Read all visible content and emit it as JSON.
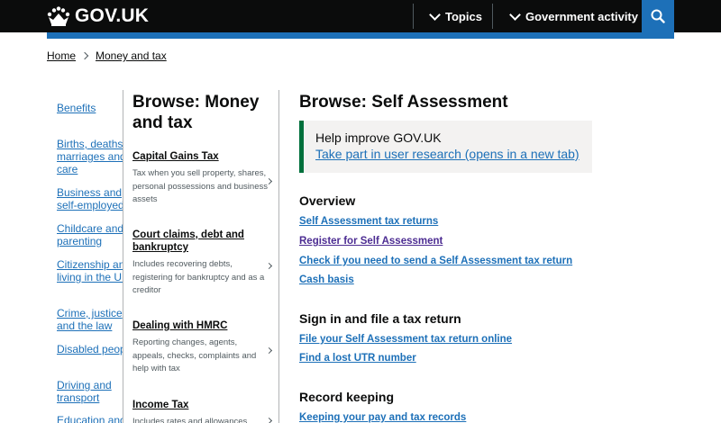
{
  "header": {
    "logo_text": "GOV.UK",
    "nav": [
      {
        "label": "Topics"
      },
      {
        "label": "Government activity"
      }
    ],
    "colors": {
      "header_bg": "#0b0c0c",
      "accent": "#1d70b8"
    }
  },
  "breadcrumb": [
    {
      "label": "Home"
    },
    {
      "label": "Money and tax"
    }
  ],
  "level1": [
    {
      "label": "Benefits"
    },
    {
      "label": "Births, deaths, marriages and care"
    },
    {
      "label": "Business and self-employed"
    },
    {
      "label": "Childcare and parenting"
    },
    {
      "label": "Citizenship and living in the UK"
    },
    {
      "label": "Crime, justice and the law"
    },
    {
      "label": "Disabled people"
    },
    {
      "label": "Driving and transport"
    },
    {
      "label": "Education and learning"
    }
  ],
  "level2": {
    "title": "Browse: Money and tax",
    "items": [
      {
        "title": "Capital Gains Tax",
        "desc": "Tax when you sell property, shares, personal possessions and business assets"
      },
      {
        "title": "Court claims, debt and bankruptcy",
        "desc": "Includes recovering debts, registering for bankruptcy and as a creditor"
      },
      {
        "title": "Dealing with HMRC",
        "desc": "Reporting changes, agents, appeals, checks, complaints and help with tax"
      },
      {
        "title": "Income Tax",
        "desc": "Includes rates and allowances"
      }
    ]
  },
  "main": {
    "title": "Browse: Self Assessment",
    "notice": {
      "text": "Help improve GOV.UK",
      "link": "Take part in user research (opens in a new tab)"
    },
    "sections": [
      {
        "heading": "Overview",
        "links": [
          "Self Assessment tax returns",
          "Register for Self Assessment",
          "Check if you need to send a Self Assessment tax return",
          "Cash basis"
        ]
      },
      {
        "heading": "Sign in and file a tax return",
        "links": [
          "File your Self Assessment tax return online",
          "Find a lost UTR number"
        ]
      },
      {
        "heading": "Record keeping",
        "links": [
          "Keeping your pay and tax records"
        ]
      }
    ]
  }
}
